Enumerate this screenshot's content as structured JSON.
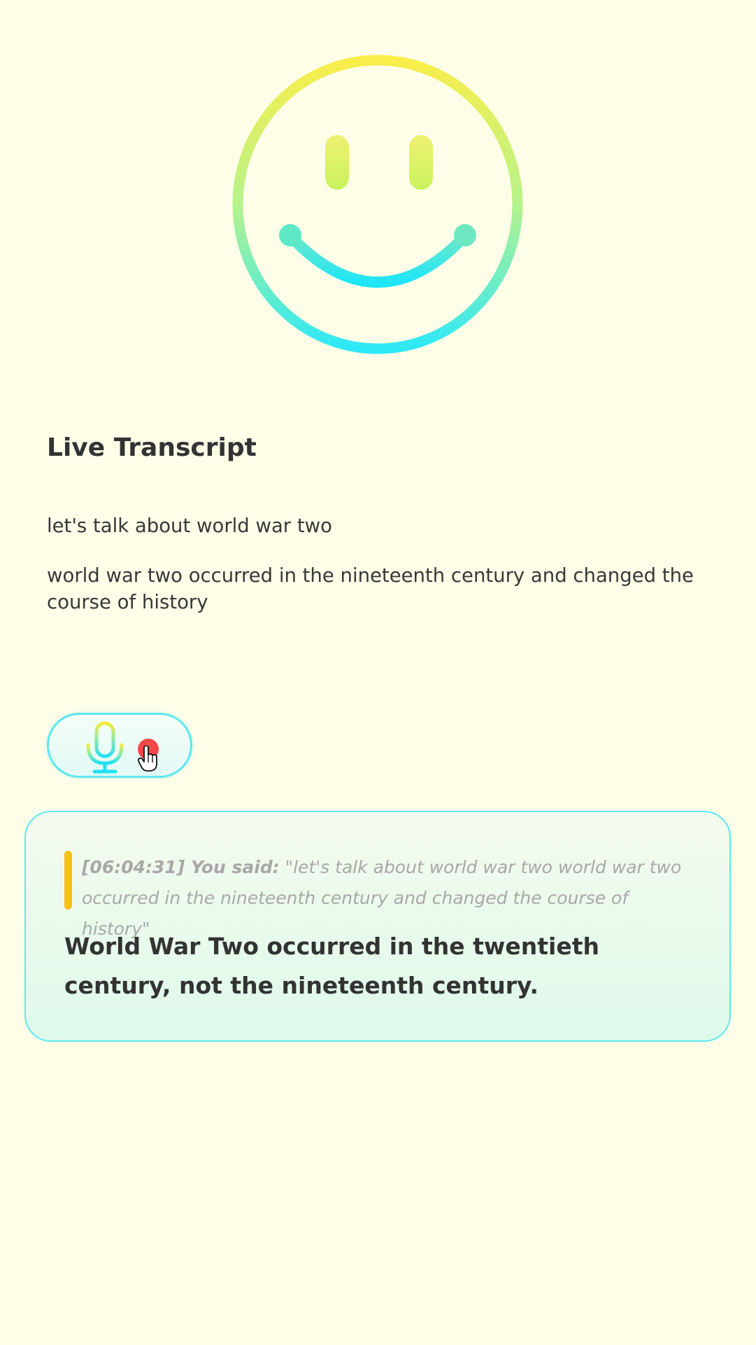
{
  "transcript": {
    "title": "Live Transcript",
    "lines": [
      "let's talk about world war two",
      "world war two occurred in the nineteenth century and changed the course of history"
    ]
  },
  "controls": {
    "mic_icon": "microphone-icon",
    "record_indicator_color": "#f44848",
    "cursor_icon": "hand-pointer-icon"
  },
  "feedback": {
    "timestamp": "[06:04:31]",
    "speaker_label": "You said:",
    "quote": "\"let's talk about world war two world war two occurred in the nineteenth century and changed the course of history\"",
    "correction": "World War Two occurred in the twentieth century, not the nineteenth century."
  },
  "colors": {
    "background": "#fefde8",
    "accent_cyan": "#2ee8f8",
    "accent_yellow": "#f8ee4a",
    "quote_bar": "#f6c112",
    "record_red": "#f44848"
  }
}
